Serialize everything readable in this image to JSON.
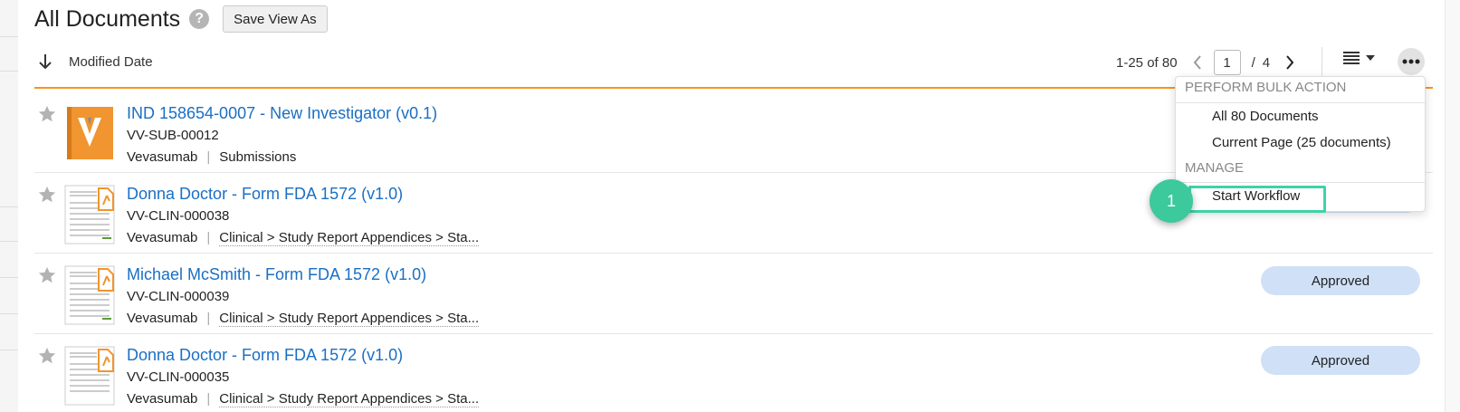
{
  "header": {
    "title": "All Documents",
    "help_glyph": "?",
    "save_view_label": "Save View As"
  },
  "sort": {
    "label": "Modified Date",
    "icon": "arrow-down-icon"
  },
  "pager": {
    "range_text": "1-25 of 80",
    "current_page": "1",
    "separator": "/",
    "total_pages": "4"
  },
  "bulk_menu": {
    "section1_header": "PERFORM BULK ACTION",
    "items1": [
      "All 80 Documents",
      "Current Page (25 documents)"
    ],
    "section2_header": "MANAGE",
    "items2": [
      "Start Workflow"
    ]
  },
  "callout": {
    "number": "1",
    "color": "#3cc99c"
  },
  "colors": {
    "accent_orange": "#f7941d",
    "link_blue": "#1a6fc4",
    "status_bg": "#cfe0f7"
  },
  "documents": [
    {
      "title": "IND 158654-0007 - New Investigator (v0.1)",
      "number": "VV-SUB-00012",
      "product": "Vevasumab",
      "path": "Submissions",
      "status": "",
      "thumb": "vault-logo"
    },
    {
      "title": "Donna Doctor - Form FDA 1572 (v1.0)",
      "number": "VV-CLIN-000038",
      "product": "Vevasumab",
      "path": "Clinical > Study Report Appendices > Sta...",
      "status": "",
      "thumb": "form-thumbnail"
    },
    {
      "title": "Michael McSmith - Form FDA 1572 (v1.0)",
      "number": "VV-CLIN-000039",
      "product": "Vevasumab",
      "path": "Clinical > Study Report Appendices > Sta...",
      "status": "Approved",
      "thumb": "form-thumbnail"
    },
    {
      "title": "Donna Doctor - Form FDA 1572 (v1.0)",
      "number": "VV-CLIN-000035",
      "product": "Vevasumab",
      "path": "Clinical > Study Report Appendices > Sta...",
      "status": "Approved",
      "thumb": "form-thumbnail"
    }
  ]
}
